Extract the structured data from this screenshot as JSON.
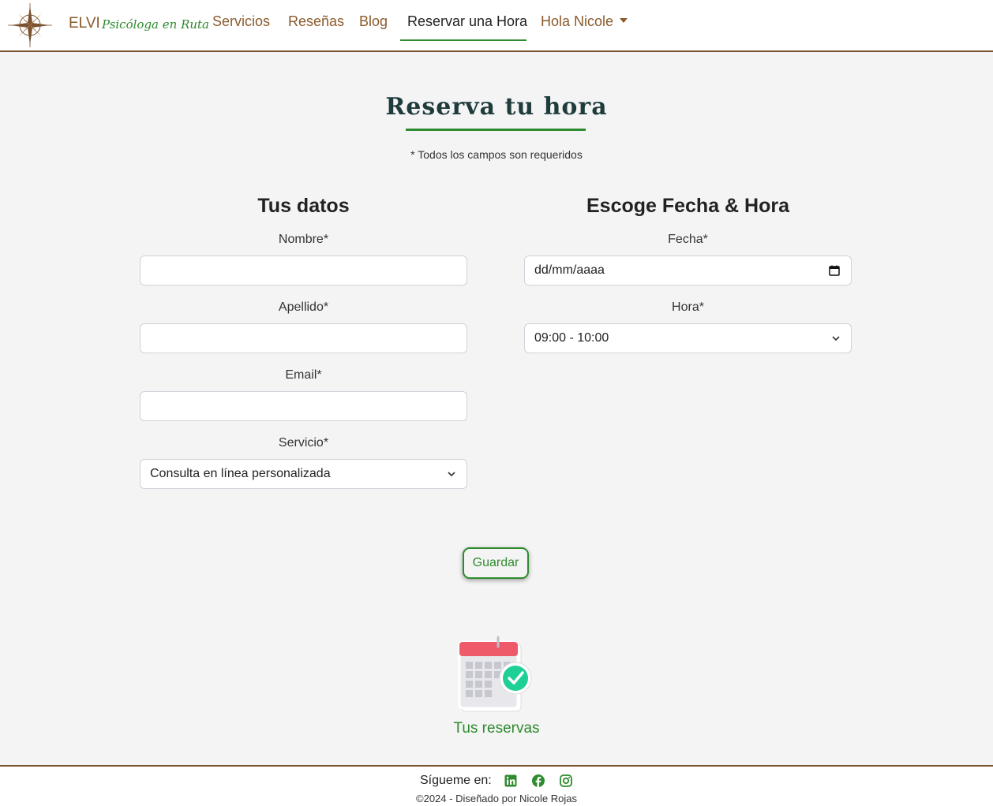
{
  "brand": {
    "name": "ELVI",
    "tagline": "Psicóloga en Ruta"
  },
  "nav": {
    "items": [
      {
        "label": "Servicios"
      },
      {
        "label": "Reseñas"
      },
      {
        "label": "Blog"
      },
      {
        "label": "Reservar una Hora",
        "active": true
      },
      {
        "label": "Hola Nicole",
        "dropdown": true
      }
    ]
  },
  "page": {
    "title": "Reserva tu hora",
    "required_note": "* Todos los campos son requeridos"
  },
  "personal": {
    "title": "Tus datos",
    "nombre_label": "Nombre*",
    "nombre_value": "",
    "apellido_label": "Apellido*",
    "apellido_value": "",
    "email_label": "Email*",
    "email_value": "",
    "servicio_label": "Servicio*",
    "servicio_value": "Consulta en línea personalizada"
  },
  "schedule": {
    "title": "Escoge Fecha & Hora",
    "fecha_label": "Fecha*",
    "fecha_placeholder": "dd/mm/aaaa",
    "hora_label": "Hora*",
    "hora_value": "09:00 - 10:00"
  },
  "actions": {
    "save_label": "Guardar"
  },
  "reservas": {
    "label": "Tus reservas",
    "icon": "calendar-check-icon"
  },
  "footer": {
    "follow_label": "Sígueme en:",
    "social_icons": [
      "linkedin-icon",
      "facebook-icon",
      "instagram-icon"
    ],
    "copyright": "©2024 - Diseñado por Nicole Rojas"
  },
  "colors": {
    "accent": "#2e8b2e",
    "brand": "#8a5a2b",
    "background": "#f4f4f4",
    "border": "#7a5230"
  }
}
